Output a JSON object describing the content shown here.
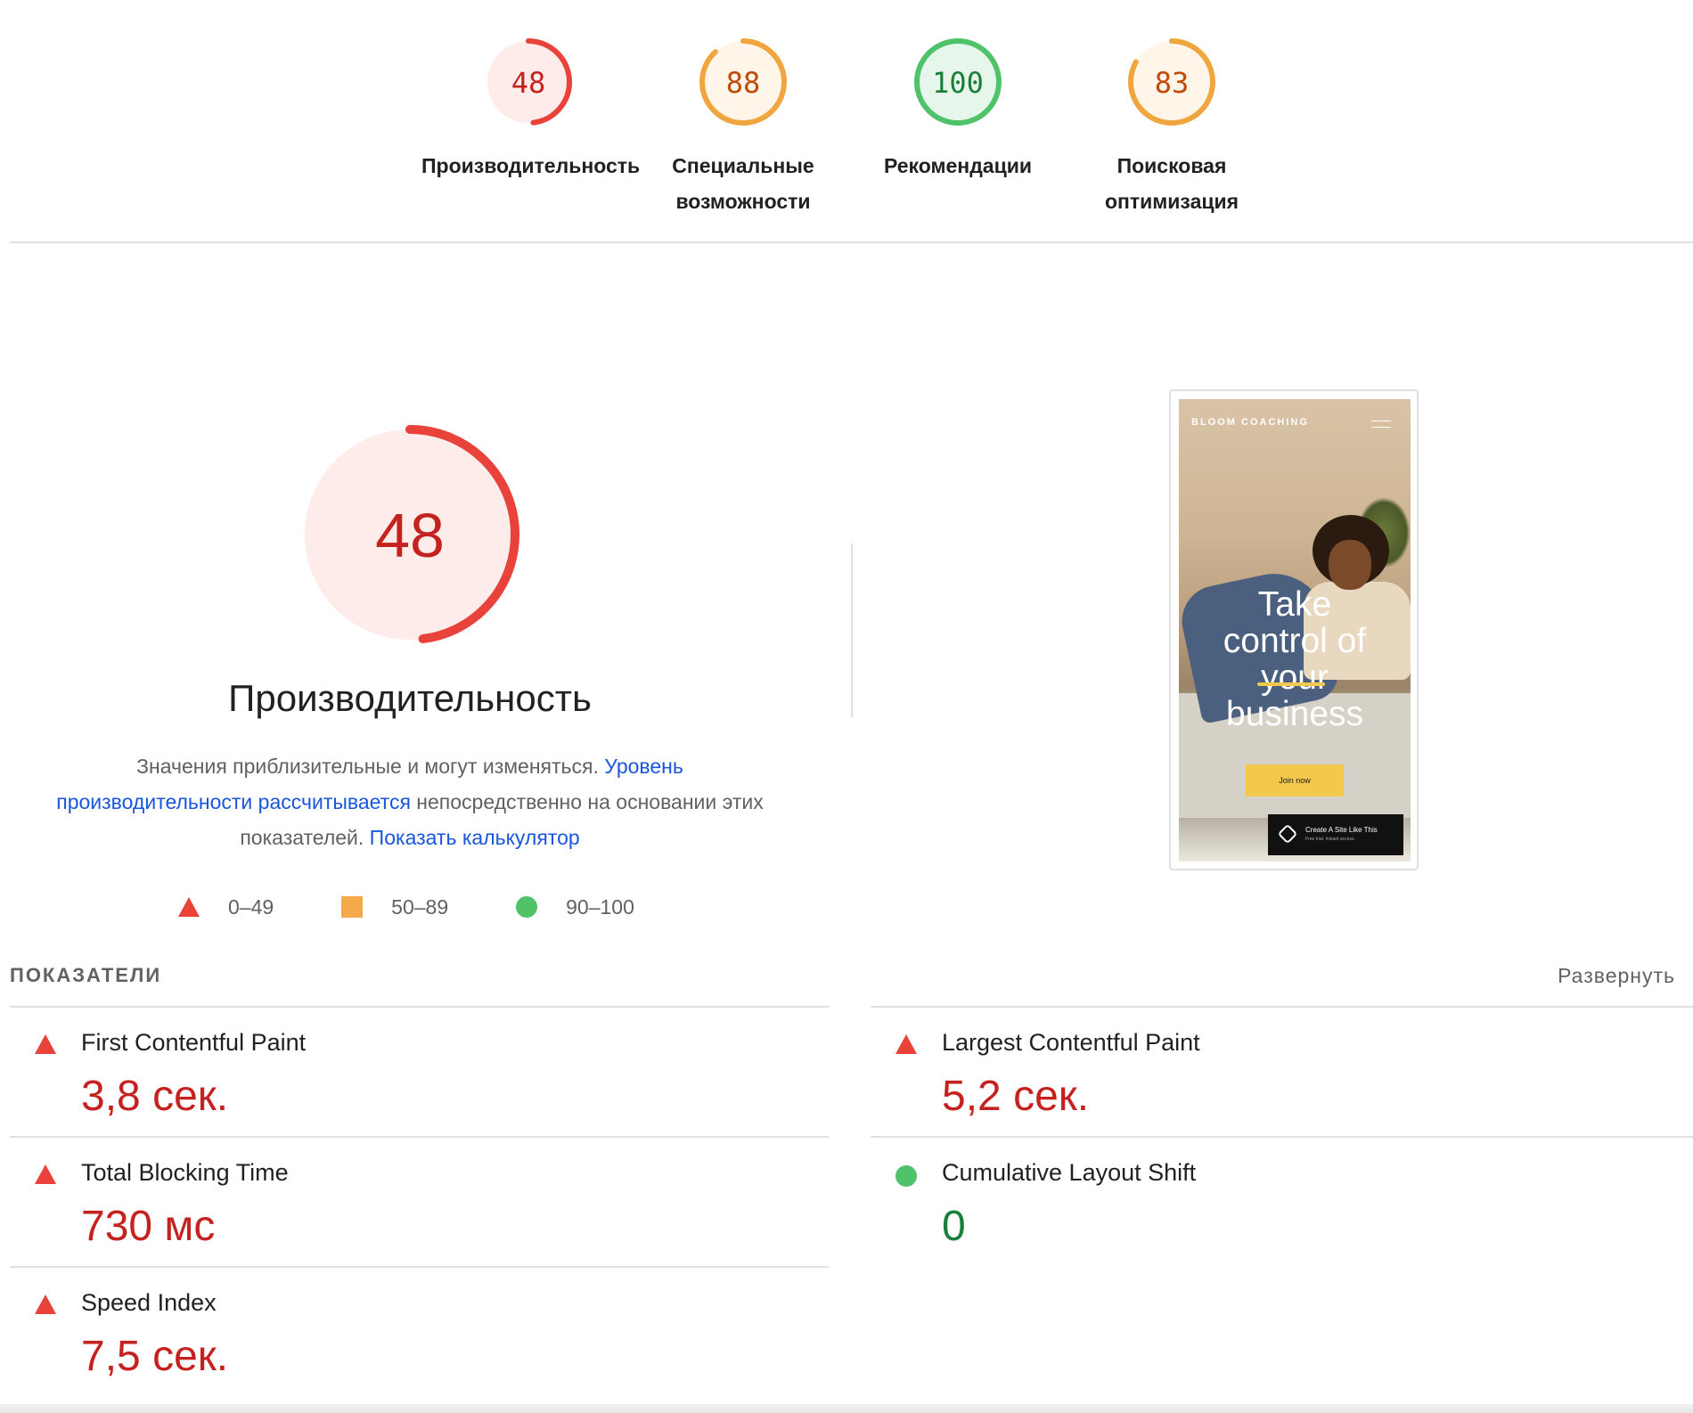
{
  "categories": [
    {
      "score": "48",
      "label": "Производительность",
      "level": "bad",
      "fraction": 0.48,
      "stroke": "#e8423a",
      "fill": "#fdecea",
      "text_color": "#c5221f"
    },
    {
      "score": "88",
      "label": "Специальные возможности",
      "level": "average",
      "fraction": 0.88,
      "stroke": "#f0a53f",
      "fill": "#fff5e8",
      "text_color": "#c04a08"
    },
    {
      "score": "100",
      "label": "Рекомендации",
      "level": "good",
      "fraction": 1.0,
      "stroke": "#4fc26a",
      "fill": "#e7f6ea",
      "text_color": "#188038"
    },
    {
      "score": "83",
      "label": "Поисковая оптимизация",
      "level": "average",
      "fraction": 0.83,
      "stroke": "#f0a53f",
      "fill": "#fff5e8",
      "text_color": "#c04a08"
    }
  ],
  "main": {
    "score": "48",
    "fraction": 0.48,
    "title": "Производительность",
    "desc_plain_1": "Значения приблизительные и могут изменяться. ",
    "desc_link_1": "Уровень производительности рассчитывается",
    "desc_plain_2": " непосредственно на основании этих показателей. ",
    "desc_link_2": "Показать калькулятор",
    "colors": {
      "stroke": "#e8423a",
      "fill": "#fdecea",
      "text": "#c5221f"
    }
  },
  "legend": [
    {
      "range": "0–49",
      "shape": "triangle",
      "color": "#e8423a"
    },
    {
      "range": "50–89",
      "shape": "square",
      "color": "#f5a94a"
    },
    {
      "range": "90–100",
      "shape": "circle",
      "color": "#4fc26a"
    }
  ],
  "screenshot": {
    "brand": "BLOOM COACHING",
    "headline_1": "Take",
    "headline_2": "control of",
    "headline_3": "your",
    "headline_4": "business",
    "cta": "Join now",
    "badge_title": "Create A Site Like This",
    "badge_sub": "Free trial. Instant access."
  },
  "metrics_section": {
    "title": "ПОКАЗАТЕЛИ",
    "expand_label": "Развернуть"
  },
  "metrics": [
    {
      "label": "First Contentful Paint",
      "value": "3,8 сек.",
      "status": "bad",
      "icon": "warning-triangle-icon"
    },
    {
      "label": "Largest Contentful Paint",
      "value": "5,2 сек.",
      "status": "bad",
      "icon": "warning-triangle-icon"
    },
    {
      "label": "Total Blocking Time",
      "value": "730 мс",
      "status": "bad",
      "icon": "warning-triangle-icon"
    },
    {
      "label": "Cumulative Layout Shift",
      "value": "0",
      "status": "good",
      "icon": "pass-circle-icon"
    },
    {
      "label": "Speed Index",
      "value": "7,5 сек.",
      "status": "bad",
      "icon": "warning-triangle-icon"
    }
  ]
}
